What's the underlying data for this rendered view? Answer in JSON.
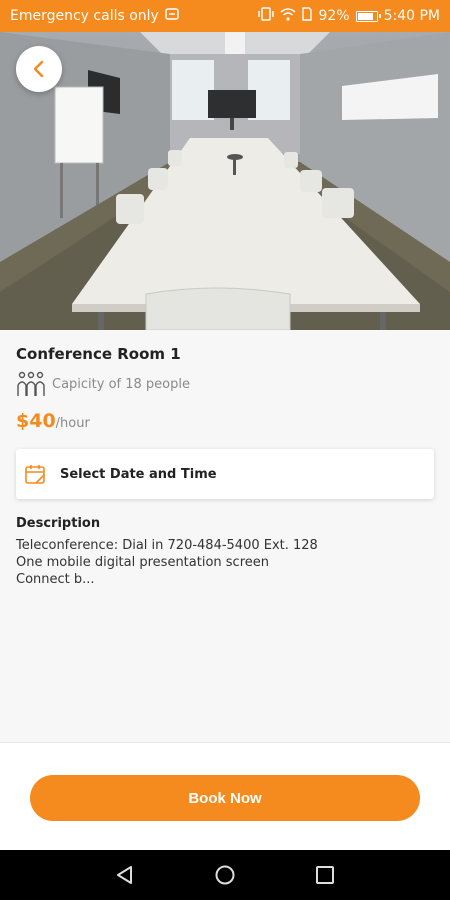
{
  "status_bar": {
    "carrier_text": "Emergency calls only",
    "battery_percent": "92%",
    "battery_level": 0.92,
    "time": "5:40 PM"
  },
  "hero": {
    "image_name": "conference-room-photo"
  },
  "room": {
    "name": "Conference Room 1",
    "capacity_text": "Capicity of 18 people",
    "price_amount": "$40",
    "price_unit": "/hour"
  },
  "date_picker": {
    "label": "Select Date and Time",
    "icon": "calendar-icon"
  },
  "description": {
    "title": "Description",
    "lines": [
      "Teleconference: Dial in 720-484-5400 Ext. 128",
      "One mobile digital presentation screen",
      "Connect b..."
    ]
  },
  "actions": {
    "book_label": "Book Now"
  },
  "colors": {
    "accent": "#f58a1f",
    "background": "#f7f7f7"
  }
}
